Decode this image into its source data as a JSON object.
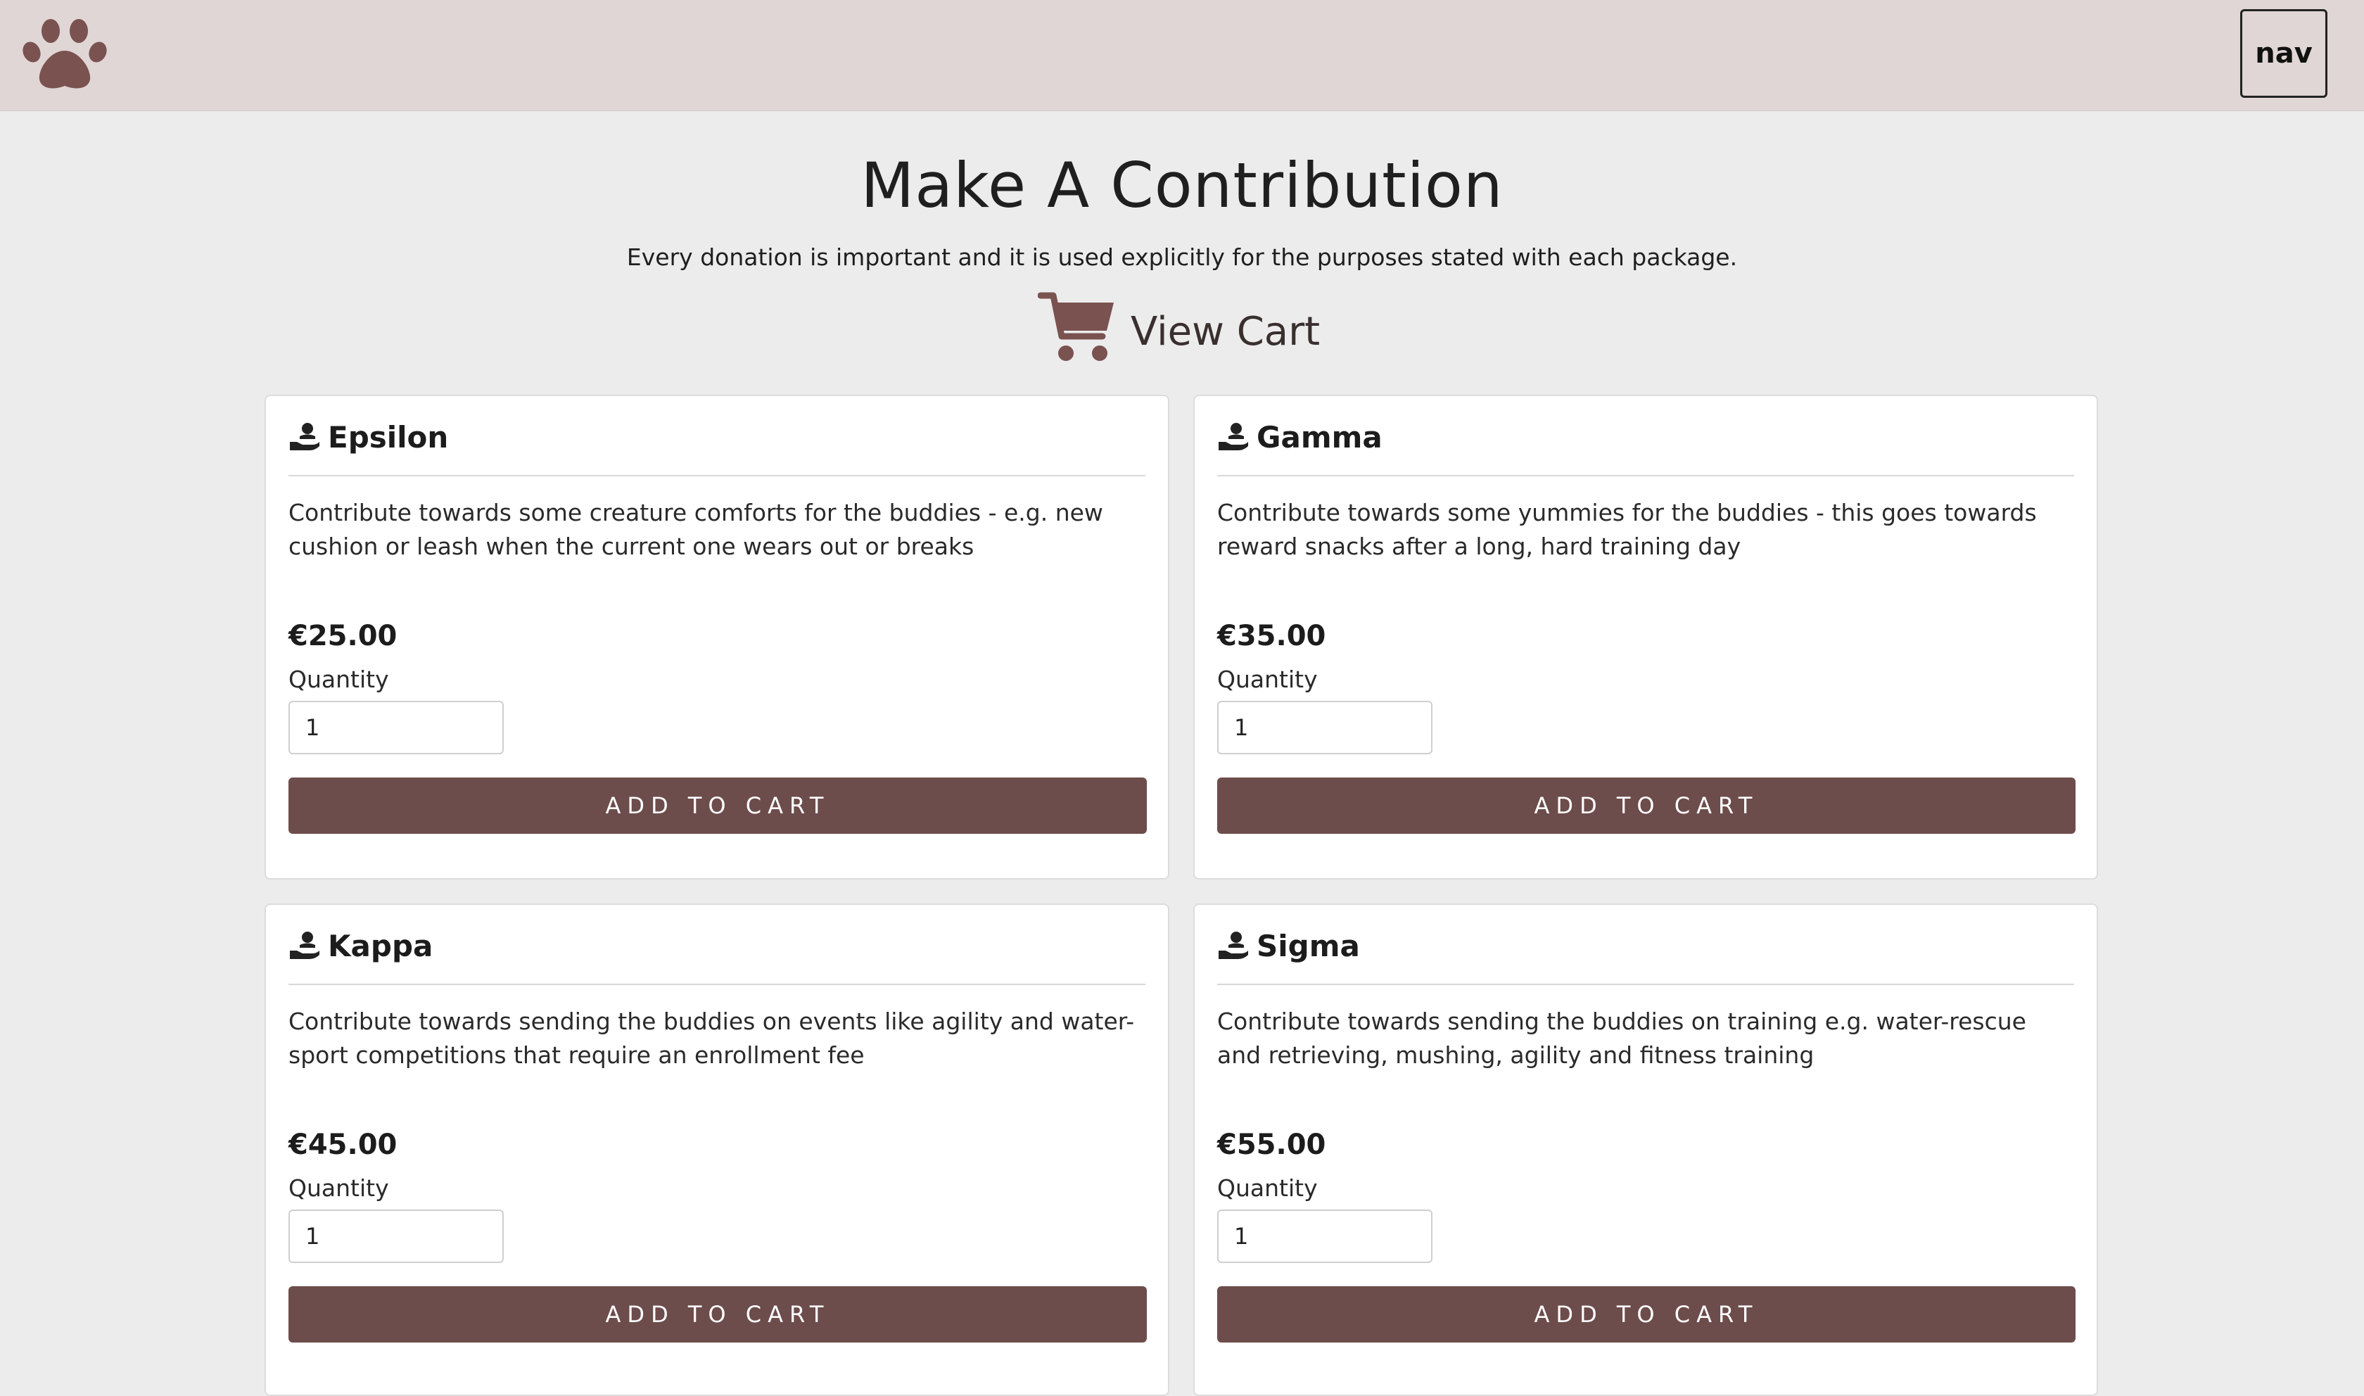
{
  "header": {
    "logo_icon": "paw-icon",
    "nav_label": "nav"
  },
  "main": {
    "title": "Make A Contribution",
    "subtitle": "Every donation is important and it is used explicitly for the purposes stated with each package.",
    "view_cart": {
      "icon": "shopping-cart-icon",
      "label": "View Cart"
    }
  },
  "packages": [
    {
      "icon": "hand-holding-heart-icon",
      "name": "Epsilon",
      "description": "Contribute towards some creature comforts for the buddies - e.g. new cushion or leash when the current one wears out or breaks",
      "price": "€25.00",
      "quantity_label": "Quantity",
      "quantity_value": "1",
      "button_label": "ADD TO CART"
    },
    {
      "icon": "hand-holding-heart-icon",
      "name": "Gamma",
      "description": "Contribute towards some yummies for the buddies - this goes towards reward snacks after a long, hard training day",
      "price": "€35.00",
      "quantity_label": "Quantity",
      "quantity_value": "1",
      "button_label": "ADD TO CART"
    },
    {
      "icon": "hand-holding-heart-icon",
      "name": "Kappa",
      "description": "Contribute towards sending the buddies on events like agility and water-sport competitions that require an enrollment fee",
      "price": "€45.00",
      "quantity_label": "Quantity",
      "quantity_value": "1",
      "button_label": "ADD TO CART"
    },
    {
      "icon": "hand-holding-heart-icon",
      "name": "Sigma",
      "description": "Contribute towards sending the buddies on training e.g. water-rescue and retrieving, mushing, agility and fitness training",
      "price": "€55.00",
      "quantity_label": "Quantity",
      "quantity_value": "1",
      "button_label": "ADD TO CART"
    }
  ],
  "colors": {
    "header_bg": "#e0d6d5",
    "page_bg": "#ececec",
    "brand": "#6d4c4c",
    "icon_brown": "#7a5250"
  }
}
